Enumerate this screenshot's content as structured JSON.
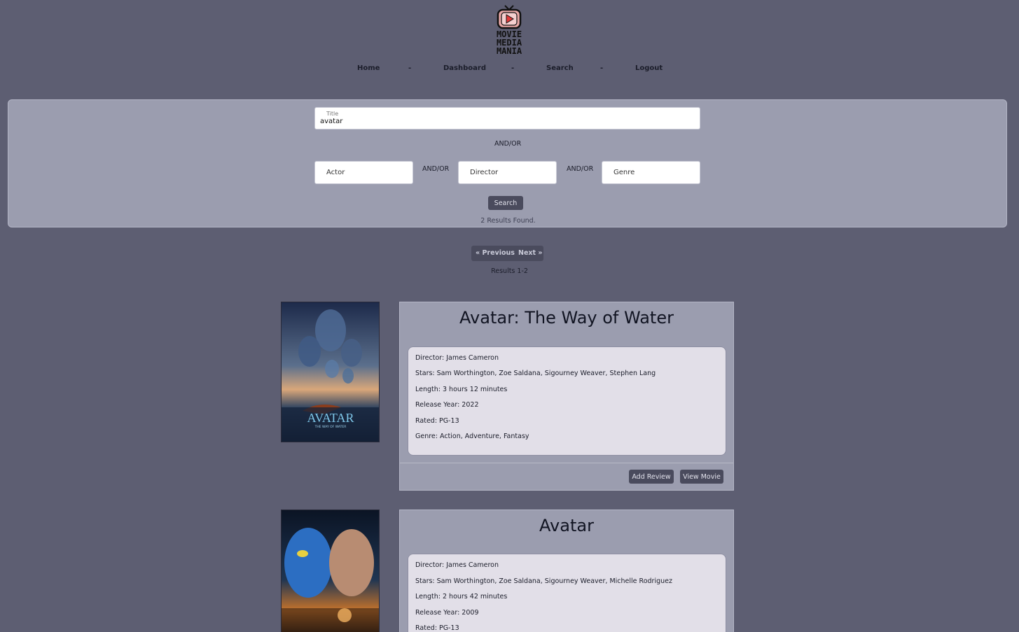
{
  "brand": {
    "line1": "MOVIE",
    "line2": "MEDIA",
    "line3": "MANIA"
  },
  "nav": {
    "home": "Home",
    "sep": "-",
    "dashboard": "Dashboard",
    "search": "Search",
    "logout": "Logout"
  },
  "search_form": {
    "title_label": "Title",
    "title_value": "avatar",
    "andor": "AND/OR",
    "actor_placeholder": "Actor",
    "director_placeholder": "Director",
    "genre_placeholder": "Genre",
    "search_button": "Search",
    "results_found": "2 Results Found."
  },
  "pager": {
    "prev": "« Previous",
    "next": "Next »",
    "range": "Results 1-2"
  },
  "movies": [
    {
      "title": "Avatar: The Way of Water",
      "director": "Director: James Cameron",
      "stars": "Stars: Sam Worthington, Zoe Saldana, Sigourney Weaver, Stephen Lang",
      "length": "Length: 3 hours 12 minutes",
      "year": "Release Year: 2022",
      "rated": "Rated: PG-13",
      "genre": "Genre: Action, Adventure, Fantasy",
      "poster_title": "AVATAR",
      "poster_subtitle": "THE WAY OF WATER",
      "add_review": "Add Review",
      "view_movie": "View Movie"
    },
    {
      "title": "Avatar",
      "director": "Director: James Cameron",
      "stars": "Stars: Sam Worthington, Zoe Saldana, Sigourney Weaver, Michelle Rodriguez",
      "length": "Length: 2 hours 42 minutes",
      "year": "Release Year: 2009",
      "rated": "Rated: PG-13"
    }
  ],
  "colors": {
    "background": "#5d5e72",
    "panel": "#9b9daf",
    "button": "#4a4b5d",
    "details": "#e2dfe8"
  }
}
